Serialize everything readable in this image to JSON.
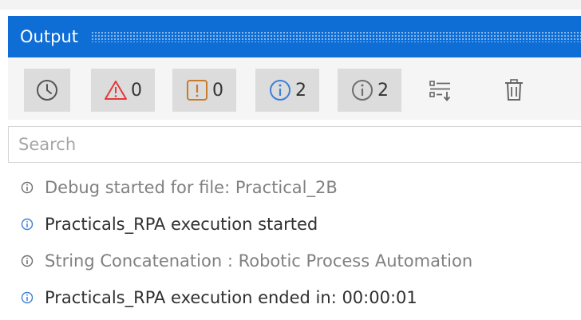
{
  "panel": {
    "title": "Output"
  },
  "toolbar": {
    "history_icon": "clock-icon",
    "errors_count": "0",
    "warnings_count": "0",
    "info_count": "2",
    "trace_count": "2",
    "filter_icon": "list-filter-icon",
    "clear_icon": "trash-icon"
  },
  "search": {
    "placeholder": "Search",
    "value": ""
  },
  "log": [
    {
      "level": "trace",
      "icon": "info-circle-icon",
      "text": "Debug started for file: Practical_2B"
    },
    {
      "level": "info",
      "icon": "info-circle-icon",
      "text": "Practicals_RPA execution started"
    },
    {
      "level": "trace",
      "icon": "info-circle-icon",
      "text": "String Concatenation : Robotic Process Automation"
    },
    {
      "level": "info",
      "icon": "info-circle-icon",
      "text": "Practicals_RPA execution ended in: 00:00:01"
    }
  ],
  "colors": {
    "titlebar": "#0e6ed6",
    "error": "#e23a3a",
    "warning": "#c97a2a",
    "info": "#3e7fd6",
    "trace": "#6e6e6e"
  }
}
